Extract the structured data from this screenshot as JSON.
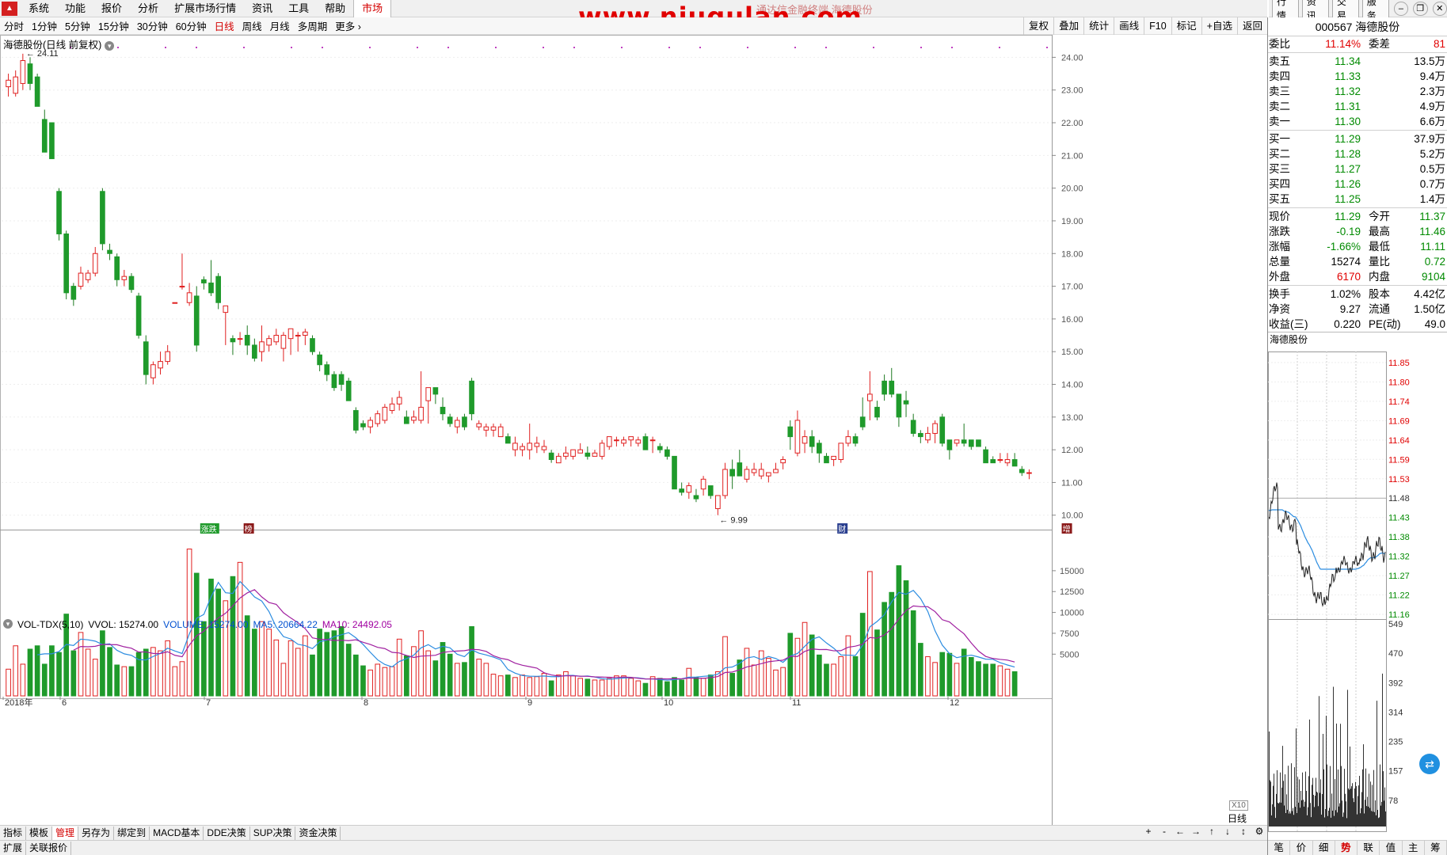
{
  "menubar": {
    "items": [
      "系统",
      "功能",
      "报价",
      "分析",
      "扩展市场行情",
      "资讯",
      "工具",
      "帮助",
      "市场"
    ],
    "active_index": 8,
    "watermark": "www.niugulan.com",
    "subtitle": "通达信金融终端 海德股份"
  },
  "topright": {
    "buttons": [
      "行情",
      "资讯",
      "交易",
      "服务"
    ]
  },
  "periodbar": {
    "items": [
      "分时",
      "1分钟",
      "5分钟",
      "15分钟",
      "30分钟",
      "60分钟",
      "日线",
      "周线",
      "月线",
      "多周期",
      "更多"
    ],
    "active_index": 6,
    "tools": [
      "复权",
      "叠加",
      "统计",
      "画线",
      "F10",
      "标记",
      "+自选",
      "返回"
    ]
  },
  "chart": {
    "title": "海德股份(日线 前复权)",
    "high_label": "24.11",
    "low_label": "9.99",
    "price_ticks": [
      "24.00",
      "23.00",
      "22.00",
      "21.00",
      "20.00",
      "19.00",
      "18.00",
      "17.00",
      "16.00",
      "15.00",
      "14.00",
      "13.00",
      "12.00",
      "11.00",
      "10.00"
    ],
    "vol_ticks": [
      "15000",
      "12500",
      "10000",
      "7500",
      "5000"
    ],
    "x_labels": [
      "2018年",
      "6",
      "7",
      "8",
      "9",
      "10",
      "11",
      "12"
    ],
    "period_label": "日线",
    "x10": "X10",
    "markers": [
      "涨跌",
      "榜",
      "财",
      "增"
    ]
  },
  "chart_data": {
    "type": "candlestick",
    "title": "海德股份(日线 前复权)",
    "ylim": [
      9.8,
      24.3
    ],
    "candles_ohlc": [
      [
        23.1,
        23.5,
        22.8,
        23.3
      ],
      [
        22.9,
        23.6,
        22.8,
        23.4
      ],
      [
        23.2,
        24.11,
        23.0,
        23.9
      ],
      [
        23.8,
        24.0,
        23.0,
        23.2
      ],
      [
        23.4,
        23.5,
        22.6,
        22.5
      ],
      [
        22.1,
        22.4,
        21.2,
        21.1
      ],
      [
        22.0,
        22.0,
        20.9,
        20.9
      ],
      [
        19.9,
        20.0,
        18.4,
        18.6
      ],
      [
        18.6,
        18.7,
        16.6,
        16.8
      ],
      [
        17.0,
        17.1,
        16.4,
        16.6
      ],
      [
        17.0,
        17.6,
        16.9,
        17.4
      ],
      [
        17.2,
        17.5,
        17.1,
        17.4
      ],
      [
        17.4,
        18.2,
        17.3,
        18.0
      ],
      [
        19.9,
        20.0,
        18.1,
        18.3
      ],
      [
        18.1,
        18.3,
        17.8,
        18.0
      ],
      [
        17.9,
        18.0,
        17.0,
        17.2
      ],
      [
        17.2,
        17.5,
        17.0,
        17.3
      ],
      [
        17.3,
        17.4,
        16.8,
        16.9
      ],
      [
        16.7,
        16.8,
        15.4,
        15.5
      ],
      [
        15.3,
        15.5,
        14.0,
        14.3
      ],
      [
        14.2,
        14.7,
        14.0,
        14.6
      ],
      [
        14.5,
        15.0,
        14.3,
        14.7
      ],
      [
        14.7,
        15.2,
        14.6,
        15.0
      ],
      [
        16.5,
        16.5,
        16.5,
        16.5
      ],
      [
        17.0,
        18.0,
        16.9,
        17.0
      ],
      [
        16.5,
        17.1,
        16.4,
        16.8
      ],
      [
        16.7,
        17.0,
        15.0,
        15.2
      ],
      [
        17.2,
        17.3,
        16.9,
        17.1
      ],
      [
        17.1,
        17.8,
        16.7,
        16.8
      ],
      [
        17.3,
        17.4,
        16.3,
        16.5
      ],
      [
        16.2,
        16.4,
        15.2,
        16.4
      ],
      [
        15.4,
        15.5,
        14.9,
        15.3
      ],
      [
        15.4,
        15.6,
        15.2,
        15.4
      ],
      [
        15.5,
        15.8,
        14.9,
        15.2
      ],
      [
        15.2,
        15.4,
        14.7,
        14.8
      ],
      [
        15.0,
        15.8,
        14.7,
        15.3
      ],
      [
        15.2,
        15.5,
        15.0,
        15.4
      ],
      [
        15.3,
        15.7,
        15.2,
        15.5
      ],
      [
        15.1,
        15.6,
        14.7,
        15.5
      ],
      [
        15.4,
        15.7,
        14.9,
        15.7
      ],
      [
        15.5,
        15.6,
        15.0,
        15.5
      ],
      [
        15.5,
        15.7,
        15.2,
        15.6
      ],
      [
        15.4,
        15.5,
        14.9,
        15.0
      ],
      [
        14.9,
        15.0,
        14.4,
        14.6
      ],
      [
        14.6,
        14.7,
        14.1,
        14.3
      ],
      [
        14.3,
        14.4,
        13.8,
        13.9
      ],
      [
        14.3,
        14.4,
        13.8,
        14.0
      ],
      [
        14.1,
        14.2,
        13.5,
        13.5
      ],
      [
        13.2,
        13.3,
        12.5,
        12.6
      ],
      [
        12.8,
        12.9,
        12.6,
        12.7
      ],
      [
        12.7,
        13.0,
        12.5,
        12.9
      ],
      [
        12.8,
        13.2,
        12.7,
        13.1
      ],
      [
        12.9,
        13.4,
        12.8,
        13.3
      ],
      [
        13.2,
        13.6,
        13.1,
        13.4
      ],
      [
        13.4,
        13.8,
        13.2,
        13.6
      ],
      [
        13.0,
        13.2,
        12.8,
        12.8
      ],
      [
        12.9,
        13.2,
        12.8,
        13.0
      ],
      [
        12.9,
        14.4,
        12.8,
        13.3
      ],
      [
        13.5,
        13.9,
        12.8,
        13.9
      ],
      [
        13.9,
        13.9,
        13.4,
        13.7
      ],
      [
        13.3,
        13.6,
        12.9,
        13.1
      ],
      [
        13.0,
        13.1,
        12.7,
        12.8
      ],
      [
        12.7,
        13.0,
        12.5,
        12.9
      ],
      [
        13.0,
        13.1,
        12.6,
        12.7
      ],
      [
        14.1,
        14.2,
        12.9,
        13.1
      ],
      [
        12.7,
        12.9,
        12.6,
        12.8
      ],
      [
        12.6,
        12.8,
        12.4,
        12.7
      ],
      [
        12.6,
        12.8,
        12.4,
        12.7
      ],
      [
        12.4,
        12.8,
        12.4,
        12.7
      ],
      [
        12.4,
        12.5,
        12.2,
        12.2
      ],
      [
        12.0,
        12.4,
        11.8,
        12.2
      ],
      [
        12.0,
        12.2,
        11.8,
        12.1
      ],
      [
        12.0,
        12.8,
        11.7,
        12.2
      ],
      [
        12.1,
        12.4,
        11.9,
        12.2
      ],
      [
        12.0,
        12.3,
        11.9,
        12.1
      ],
      [
        11.9,
        12.0,
        11.6,
        11.7
      ],
      [
        11.6,
        11.9,
        11.6,
        11.8
      ],
      [
        11.8,
        12.1,
        11.7,
        11.9
      ],
      [
        11.8,
        12.0,
        11.7,
        12.0
      ],
      [
        11.9,
        12.2,
        11.9,
        12.0
      ],
      [
        11.9,
        12.1,
        11.7,
        11.8
      ],
      [
        11.8,
        12.0,
        11.8,
        11.9
      ],
      [
        11.8,
        12.3,
        11.7,
        12.2
      ],
      [
        12.1,
        12.3,
        12.0,
        12.4
      ],
      [
        12.3,
        12.4,
        12.1,
        12.3
      ],
      [
        12.2,
        12.4,
        12.1,
        12.3
      ],
      [
        12.3,
        12.4,
        12.1,
        12.4
      ],
      [
        12.2,
        12.4,
        12.1,
        12.3
      ],
      [
        12.4,
        12.5,
        12.0,
        12.0
      ],
      [
        12.3,
        12.4,
        11.9,
        12.3
      ],
      [
        12.1,
        12.2,
        11.9,
        12.0
      ],
      [
        12.0,
        12.1,
        11.7,
        11.8
      ],
      [
        11.8,
        11.8,
        10.8,
        10.8
      ],
      [
        10.8,
        11.0,
        10.6,
        10.7
      ],
      [
        10.7,
        11.0,
        10.5,
        10.9
      ],
      [
        10.6,
        10.8,
        10.4,
        10.5
      ],
      [
        10.8,
        11.2,
        10.6,
        11.1
      ],
      [
        10.9,
        10.9,
        10.5,
        10.6
      ],
      [
        10.2,
        10.5,
        10.0,
        10.6
      ],
      [
        10.6,
        11.6,
        10.5,
        11.4
      ],
      [
        11.4,
        11.7,
        10.8,
        11.2
      ],
      [
        11.6,
        12.0,
        11.2,
        11.2
      ],
      [
        11.1,
        11.5,
        11.0,
        11.4
      ],
      [
        11.3,
        11.6,
        11.2,
        11.4
      ],
      [
        11.2,
        11.6,
        11.1,
        11.4
      ],
      [
        11.2,
        11.3,
        11.0,
        11.3
      ],
      [
        11.3,
        11.6,
        11.3,
        11.4
      ],
      [
        11.6,
        11.8,
        11.4,
        11.7
      ],
      [
        12.7,
        12.9,
        12.0,
        12.4
      ],
      [
        11.9,
        13.2,
        11.8,
        12.9
      ],
      [
        12.2,
        12.6,
        11.9,
        12.4
      ],
      [
        12.4,
        12.6,
        11.9,
        12.1
      ],
      [
        12.2,
        12.3,
        11.6,
        11.9
      ],
      [
        11.8,
        11.9,
        11.6,
        11.6
      ],
      [
        11.7,
        11.8,
        11.5,
        11.8
      ],
      [
        11.7,
        12.1,
        11.6,
        12.2
      ],
      [
        12.2,
        12.6,
        12.1,
        12.4
      ],
      [
        12.4,
        12.5,
        12.1,
        12.2
      ],
      [
        13.0,
        13.6,
        12.6,
        12.7
      ],
      [
        13.5,
        14.4,
        12.9,
        13.7
      ],
      [
        13.3,
        13.5,
        12.9,
        13.0
      ],
      [
        14.1,
        14.3,
        13.5,
        13.7
      ],
      [
        14.1,
        14.5,
        13.6,
        13.7
      ],
      [
        13.7,
        13.7,
        12.7,
        13.0
      ],
      [
        13.5,
        13.8,
        13.0,
        13.4
      ],
      [
        12.9,
        13.1,
        12.4,
        12.5
      ],
      [
        12.5,
        12.6,
        12.2,
        12.4
      ],
      [
        12.3,
        12.7,
        12.2,
        12.5
      ],
      [
        12.5,
        12.9,
        12.2,
        12.8
      ],
      [
        13.0,
        13.1,
        12.1,
        12.2
      ],
      [
        12.3,
        12.3,
        11.7,
        12.0
      ],
      [
        12.2,
        12.3,
        12.1,
        12.3
      ],
      [
        12.3,
        12.8,
        12.1,
        12.2
      ],
      [
        12.3,
        12.3,
        12.0,
        12.1
      ],
      [
        12.3,
        12.3,
        12.1,
        12.1
      ],
      [
        12.0,
        12.1,
        11.6,
        11.6
      ],
      [
        11.7,
        11.8,
        11.6,
        11.6
      ],
      [
        11.7,
        11.9,
        11.6,
        11.7
      ],
      [
        11.6,
        11.9,
        11.5,
        11.7
      ],
      [
        11.7,
        11.9,
        11.5,
        11.5
      ],
      [
        11.4,
        11.5,
        11.2,
        11.3
      ],
      [
        11.3,
        11.4,
        11.1,
        11.3
      ]
    ],
    "volume": [
      3200,
      6000,
      3800,
      5600,
      6000,
      3800,
      6000,
      5200,
      9800,
      5400,
      7600,
      5600,
      4400,
      7800,
      5800,
      3700,
      3500,
      3500,
      5200,
      5600,
      5800,
      5400,
      6600,
      3500,
      4100,
      17600,
      14700,
      8900,
      14000,
      12800,
      11400,
      14300,
      16000,
      9600,
      8000,
      8900,
      8000,
      6700,
      3900,
      6600,
      5700,
      7200,
      4900,
      8000,
      7600,
      7800,
      8300,
      6200,
      4900,
      3600,
      3100,
      3800,
      3400,
      3500,
      6800,
      4800,
      5900,
      7800,
      5400,
      4200,
      6400,
      5000,
      3900,
      4000,
      8300,
      4400,
      3900,
      2600,
      2400,
      2500,
      2200,
      2500,
      2200,
      2300,
      2700,
      1800,
      2500,
      2900,
      2400,
      2100,
      2000,
      1900,
      1900,
      2100,
      2400,
      2400,
      2100,
      1800,
      1500,
      2300,
      2100,
      1700,
      2200,
      1900,
      3300,
      2200,
      2100,
      2500,
      2900,
      7100,
      2700,
      4300,
      5700,
      3700,
      5400,
      4500,
      3100,
      3400,
      7500,
      6900,
      8800,
      7300,
      4900,
      3800,
      3800,
      4700,
      7200,
      4700,
      9900,
      14900,
      7900,
      11200,
      12400,
      15600,
      13800,
      10200,
      6300,
      4700,
      4000,
      5200,
      5100,
      3900,
      5600,
      4600,
      4100,
      3800,
      3800,
      3600,
      3200,
      2900
    ],
    "ma5_label": "20664.22",
    "ma10_label": "24492.05",
    "volume_label": "15274.00"
  },
  "vol_legend": {
    "name": "VOL-TDX(5,10)",
    "vvol": "VVOL: 15274.00",
    "volume": "VOLUME: 15274.00",
    "ma5": "MA5: 20664.22",
    "ma10": "MA10: 24492.05"
  },
  "bottom_tabs": [
    "指标",
    "模板",
    "管理",
    "另存为",
    "绑定到",
    "MACD基本",
    "DDE决策",
    "SUP决策",
    "资金决策"
  ],
  "bottom_tabs_active": 2,
  "status_tabs": [
    "扩展",
    "关联报价"
  ],
  "bottom_nav": [
    "+",
    "-",
    "←",
    "→",
    "↑",
    "↓",
    "↕",
    "⚙"
  ],
  "quote": {
    "head": "000567 海德股份",
    "weibi_label": "委比",
    "weibi": "11.14%",
    "weicha_label": "委差",
    "weicha": "81",
    "asks": [
      {
        "label": "卖五",
        "price": "11.34",
        "vol": "13.5万"
      },
      {
        "label": "卖四",
        "price": "11.33",
        "vol": "9.4万"
      },
      {
        "label": "卖三",
        "price": "11.32",
        "vol": "2.3万"
      },
      {
        "label": "卖二",
        "price": "11.31",
        "vol": "4.9万"
      },
      {
        "label": "卖一",
        "price": "11.30",
        "vol": "6.6万"
      }
    ],
    "bids": [
      {
        "label": "买一",
        "price": "11.29",
        "vol": "37.9万"
      },
      {
        "label": "买二",
        "price": "11.28",
        "vol": "5.2万"
      },
      {
        "label": "买三",
        "price": "11.27",
        "vol": "0.5万"
      },
      {
        "label": "买四",
        "price": "11.26",
        "vol": "0.7万"
      },
      {
        "label": "买五",
        "price": "11.25",
        "vol": "1.4万"
      }
    ],
    "stats": [
      {
        "k1": "现价",
        "v1": "11.29",
        "c1": "green",
        "k2": "今开",
        "v2": "11.37",
        "c2": "green"
      },
      {
        "k1": "涨跌",
        "v1": "-0.19",
        "c1": "green",
        "k2": "最高",
        "v2": "11.46",
        "c2": "green"
      },
      {
        "k1": "涨幅",
        "v1": "-1.66%",
        "c1": "green",
        "k2": "最低",
        "v2": "11.11",
        "c2": "green"
      },
      {
        "k1": "总量",
        "v1": "15274",
        "c1": "gray",
        "k2": "量比",
        "v2": "0.72",
        "c2": "green"
      },
      {
        "k1": "外盘",
        "v1": "6170",
        "c1": "red",
        "k2": "内盘",
        "v2": "9104",
        "c2": "green"
      }
    ],
    "stats2": [
      {
        "k1": "换手",
        "v1": "1.02%",
        "k2": "股本",
        "v2": "4.42亿"
      },
      {
        "k1": "净资",
        "v1": "9.27",
        "k2": "流通",
        "v2": "1.50亿"
      },
      {
        "k1": "收益(三)",
        "v1": "0.220",
        "k2": "PE(动)",
        "v2": "49.0"
      }
    ]
  },
  "mini": {
    "title": "海德股份",
    "price_ticks": [
      "11.85",
      "11.80",
      "11.74",
      "11.69",
      "11.64",
      "11.59",
      "11.53",
      "11.48",
      "11.43",
      "11.38",
      "11.32",
      "11.27",
      "11.22",
      "11.16"
    ],
    "vol_ticks": [
      "549",
      "470",
      "392",
      "314",
      "235",
      "157",
      "78"
    ]
  },
  "rp_bottom": [
    "笔",
    "价",
    "细",
    "势",
    "联",
    "值",
    "主",
    "筹"
  ],
  "rp_bottom_active": 3
}
